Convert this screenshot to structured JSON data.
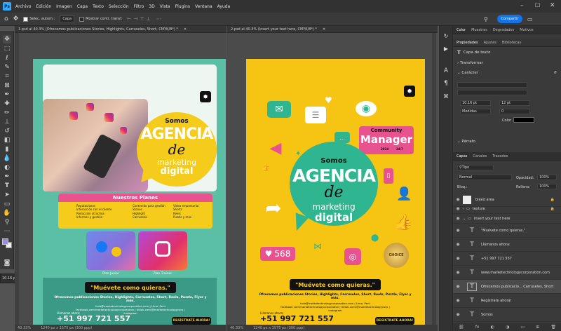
{
  "app": {
    "logo": "Ps"
  },
  "menu": [
    "Archivo",
    "Edición",
    "Imagen",
    "Capa",
    "Texto",
    "Selección",
    "Filtro",
    "3D",
    "Vista",
    "Plugins",
    "Ventana",
    "Ayuda"
  ],
  "options": {
    "autoselect": "Selec. autom.:",
    "layer_select": "Capa",
    "show_transform": "Mostrar contr. transf."
  },
  "share_label": "Compartir",
  "documents": [
    {
      "tab": "1.psd al 40.3% (Ofrecemos publicaciones Stories, Highlights, Carruseles, Short, CMYK/8*) *",
      "status_zoom": "40.33%",
      "status_size": "1240 px x 1575 px (300 ppp)"
    },
    {
      "tab": "2.psd al 40.3% (Insert your text here, CMYK/8*) *",
      "status_zoom": "40.33%",
      "status_size": "1240 px x 1575 px (300 ppp)"
    }
  ],
  "flyer1": {
    "somos": "Somos",
    "agencia": "AGENCIA",
    "de": "de",
    "marketing": "marketing",
    "digital": "digital",
    "plans_title": "Nuestros Planes",
    "plans_col1": [
      "Reputaciones",
      "Interacción con el cliente",
      "Redacción atractiva",
      "Informes y gestión"
    ],
    "plans_col2": [
      "Contenido para gestión",
      "Stories",
      "Highlight",
      "Carruseles"
    ],
    "plans_col3": [
      "Video empresarial",
      "Shorts",
      "Reels",
      "Puzzle y más"
    ],
    "plan1": "Plan Junior",
    "plan2": "Plan Trainer",
    "slogan": "\"Muévete como quieras.\"",
    "body": "Ofrecemos publicaciones Stories, Highlights, Carruseles, Short, Reels, Puzzle, Flyer y más.",
    "contact": "hola@marketechnologycorporation.com | Lima, Perú",
    "social": "facebook.com/marketechnologycorporation | tiktok.com/@marketechnologycorp |",
    "social2": "instagram",
    "call_label": "Llámanos ahora:",
    "phone": "+51 997 721 557",
    "web": "www.marketechnologycorporation.com",
    "cta": "REGÍSTRATE AHORA!"
  },
  "flyer2": {
    "community": "Community",
    "manager": "Manager",
    "year": "2024",
    "hours": "24/7",
    "somos": "Somos",
    "agencia": "AGENCIA",
    "de": "de",
    "marketing": "marketing",
    "digital": "digital",
    "likes": "568",
    "badge": "CHOICE",
    "slogan": "\"Muévete como quieras.\"",
    "body": "Ofrecemos publicaciones Stories, Highlights, Carruseles, Short, Reels, Puzzle, Flyer y más.",
    "contact": "hola@marketechnologycorporation.com | Lima, Perú",
    "social": "facebook.com/marketechnologycorporation | tiktok.com/@marketechnologycorp |",
    "social2": "instagram",
    "call_label": "Llámanos ahora:",
    "phone": "+51 997 721 557",
    "web": "www.marketechnologycorporation.com",
    "cta": "REGÍSTRATE AHORA!"
  },
  "panel": {
    "top_tabs": [
      "Color",
      "Muestras",
      "Degradados",
      "Motivos"
    ],
    "prop_tabs": [
      "Propiedades",
      "Ajustes",
      "Bibliotecas"
    ],
    "layer_type": "Capa de texto",
    "transform": "Transformar",
    "character": "Carácter",
    "font_size": "10.16 pt",
    "leading": "12 pt",
    "tracking_mode": "Medidas",
    "tracking": "0",
    "color_label": "Color",
    "parrafo": "Párrafo",
    "layer_tabs": [
      "Capas",
      "Canales",
      "Trazados"
    ],
    "kind": "Tipo",
    "blend": "Normal",
    "opacity_label": "Opacidad:",
    "opacity": "100%",
    "lock_label": "Bloq.:",
    "fill_label": "Relleno:",
    "fill": "100%",
    "layers": [
      "bleed area",
      "texture",
      "Insert your text here",
      "\"Muévete como quieras.\"",
      "Llámanos ahora:",
      "+51 997 721 557",
      "www.marketechnologycorporation.com",
      "Ofrecemos publicacio... Carruseles, Short",
      "Regístrate ahora!",
      "Somos"
    ]
  },
  "char_float": {
    "size": "10.16 pt"
  },
  "colors": {
    "teal": "#5bbfa6",
    "yellow": "#f6c514",
    "pink": "#e8538f",
    "accent": "#1473e6"
  }
}
